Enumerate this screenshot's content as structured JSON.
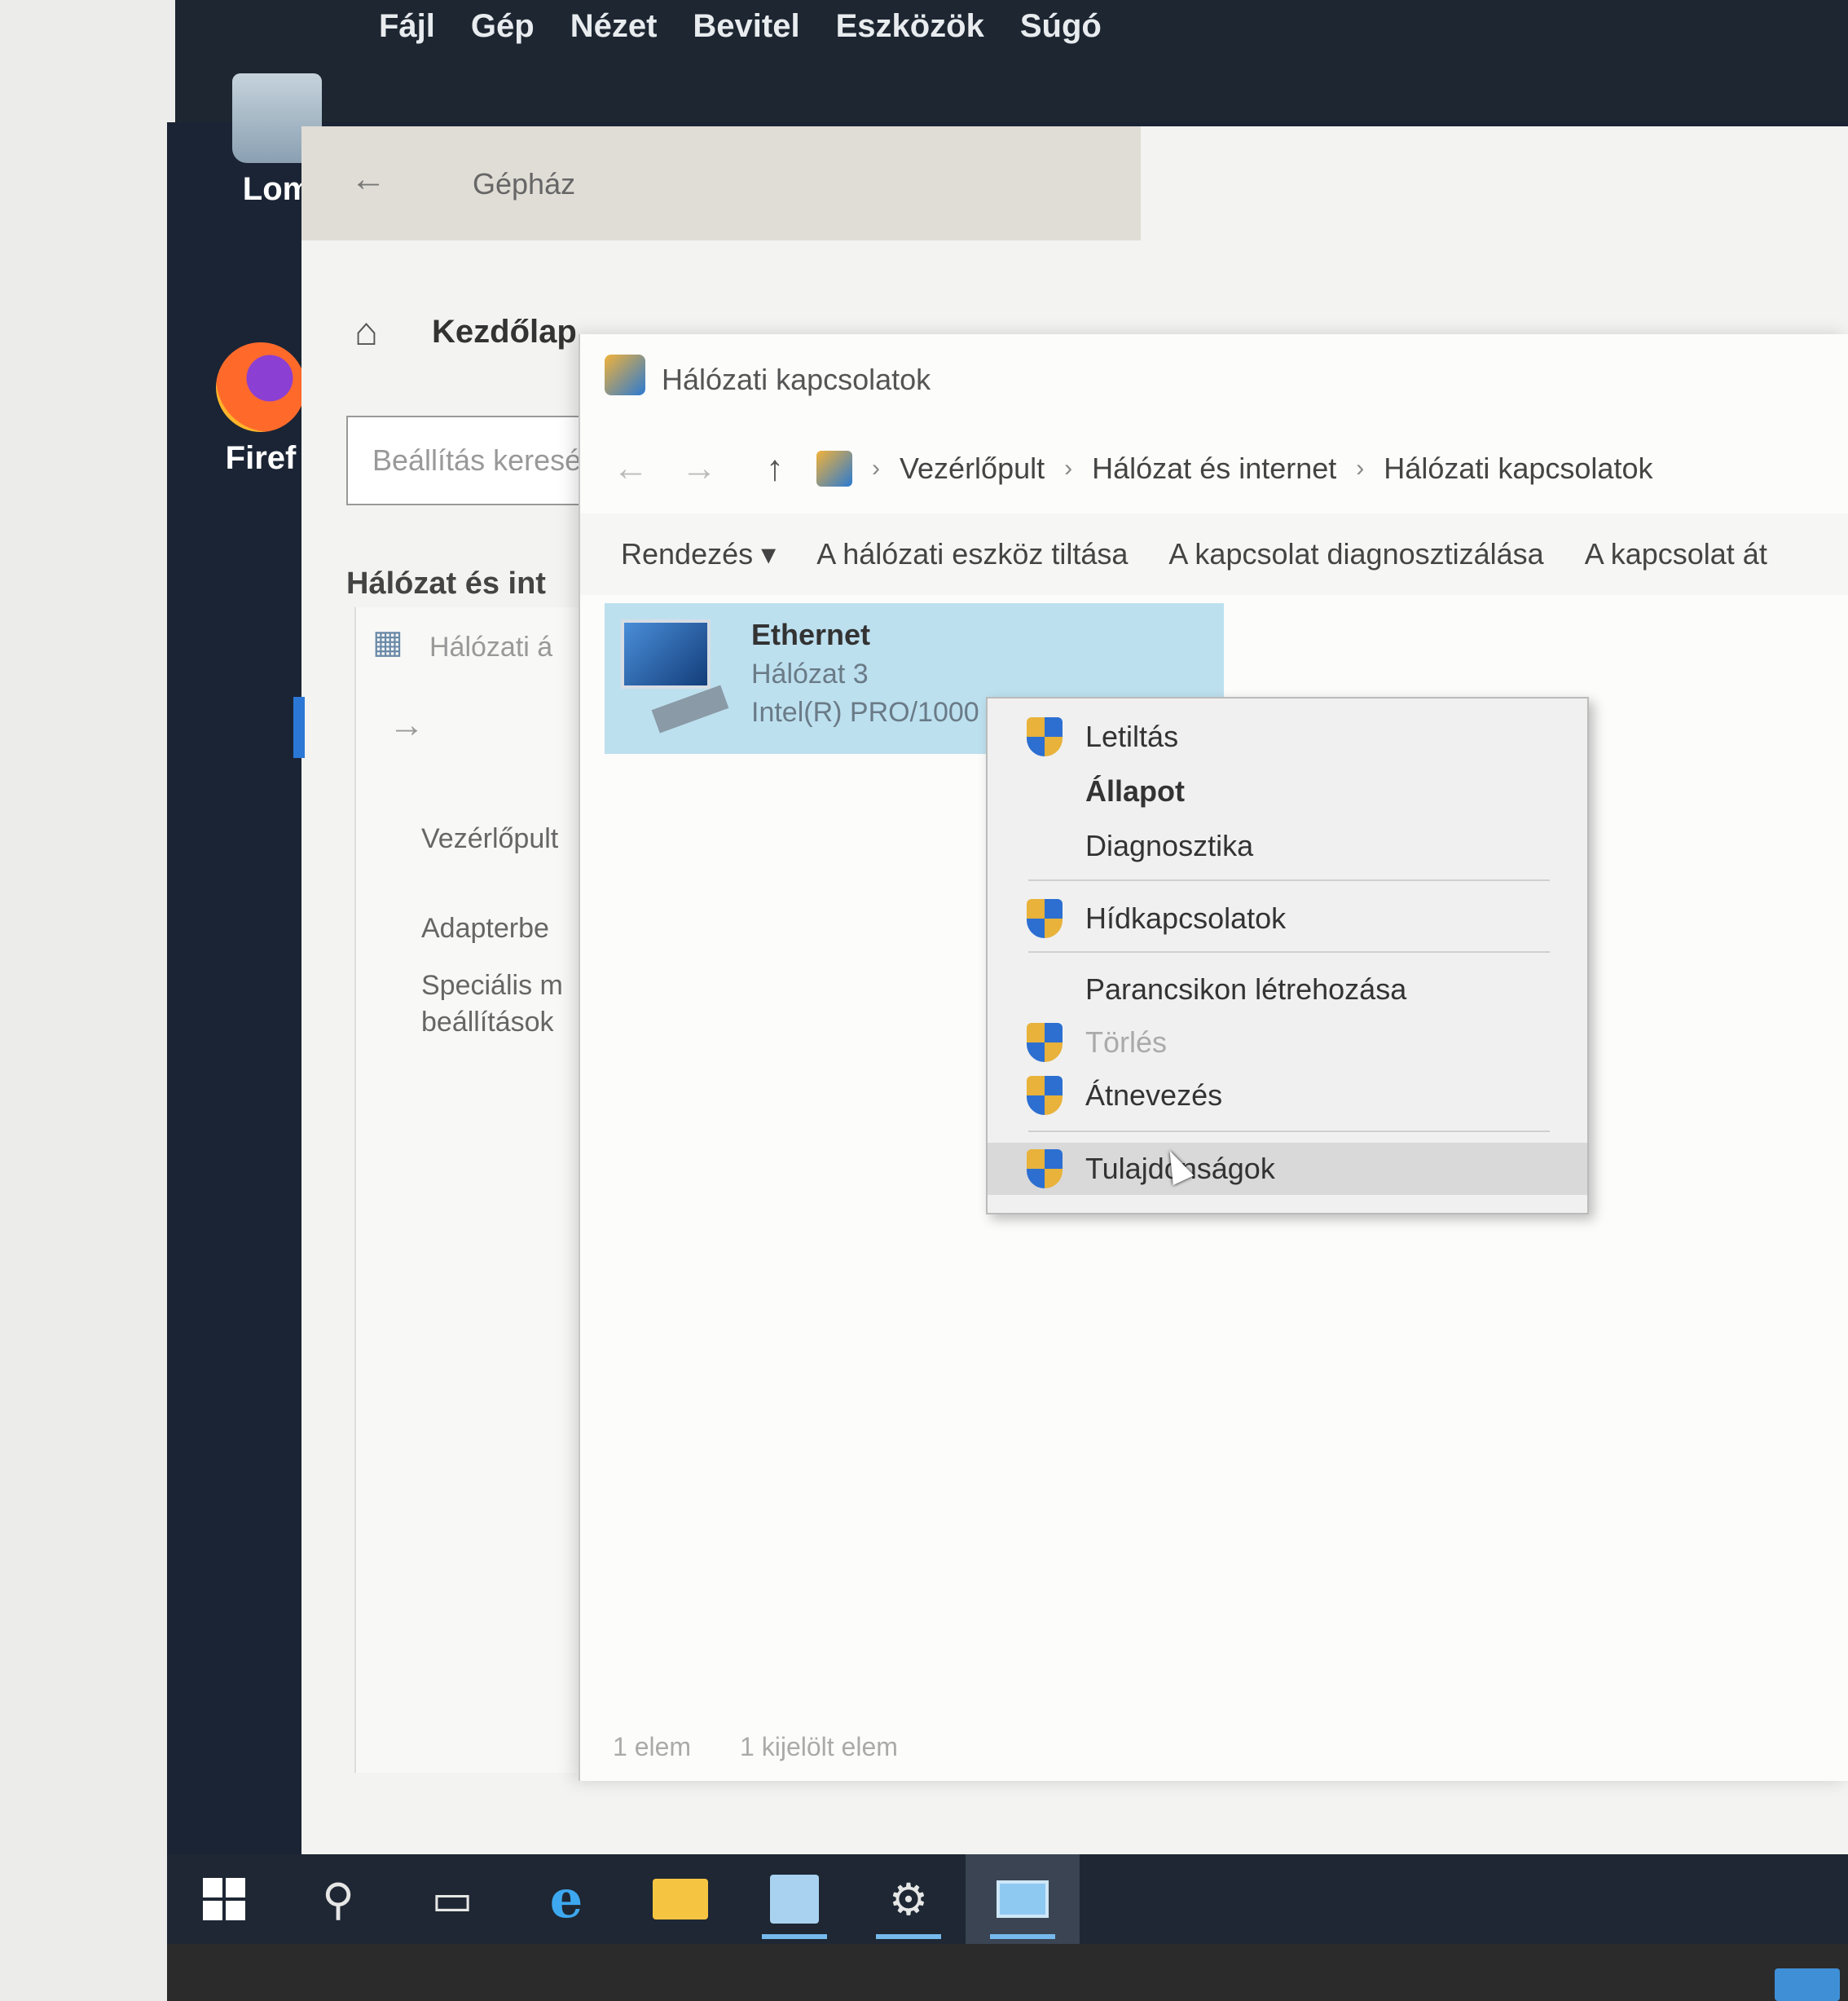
{
  "vbox_menu": [
    "Fájl",
    "Gép",
    "Nézet",
    "Bevitel",
    "Eszközök",
    "Súgó"
  ],
  "desktop": {
    "recycle_bin": "Lom",
    "firefox": "Firef"
  },
  "settings": {
    "title": "Gépház",
    "home": "Kezdőlap",
    "search_placeholder": "Beállítás keresése",
    "section": "Hálózat és int"
  },
  "netstatus": {
    "title": "Hálózati á",
    "items": [
      "Vezérlőpult",
      "Adapterbe",
      "Speciális m",
      "beállítások"
    ]
  },
  "netconn": {
    "title": "Hálózati kapcsolatok",
    "breadcrumb": [
      "Vezérlőpult",
      "Hálózat és internet",
      "Hálózati kapcsolatok"
    ],
    "commands": [
      "Rendezés ▾",
      "A hálózati eszköz tiltása",
      "A kapcsolat diagnosztizálása",
      "A kapcsolat át"
    ],
    "adapter": {
      "name": "Ethernet",
      "network": "Hálózat 3",
      "device": "Intel(R) PRO/1000 M"
    },
    "status": {
      "count": "1 elem",
      "selected": "1 kijelölt elem"
    }
  },
  "context_menu": {
    "items": [
      {
        "label": "Letiltás",
        "shield": true
      },
      {
        "label": "Állapot",
        "bold": true
      },
      {
        "label": "Diagnosztika"
      },
      {
        "label": "Hídkapcsolatok",
        "shield": true
      },
      {
        "label": "Parancsikon létrehozása"
      },
      {
        "label": "Törlés",
        "shield": true,
        "disabled": true
      },
      {
        "label": "Átnevezés",
        "shield": true
      },
      {
        "label": "Tulajdonságok",
        "shield": true,
        "highlighted": true
      }
    ]
  }
}
